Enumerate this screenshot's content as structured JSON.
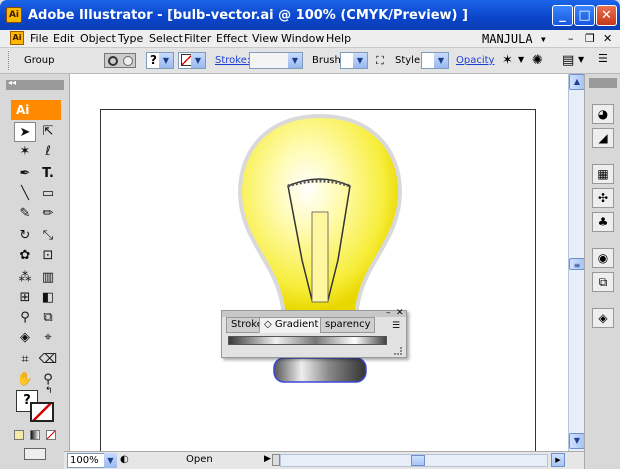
{
  "window": {
    "title": "Adobe Illustrator - [bulb-vector.ai @ 100% (CMYK/Preview) ]",
    "app_icon_text": "Ai"
  },
  "menu": {
    "items": [
      "File",
      "Edit",
      "Object",
      "Type",
      "Select",
      "Filter",
      "Effect",
      "View",
      "Window",
      "Help"
    ],
    "workspace": "MANJULA ▾",
    "icon_text": "Ai"
  },
  "control": {
    "selection_type": "Group",
    "fill_value": "?",
    "stroke_link": "Stroke:",
    "brush_label": "Brush:",
    "style_label": "Style:",
    "opacity_link": "Opacity"
  },
  "tools": {
    "badge": "Ai",
    "fill_unknown": "?"
  },
  "float_panel": {
    "tabs": [
      "Stroke",
      "◇ Gradient ✕",
      "sparency"
    ],
    "close": "✕",
    "min": "–"
  },
  "status": {
    "zoom": "100%",
    "status_text": "Open"
  },
  "colors": {
    "title_blue": "#0a44c9",
    "accent_orange": "#ff8a00",
    "link_blue": "#1a3fd4"
  }
}
